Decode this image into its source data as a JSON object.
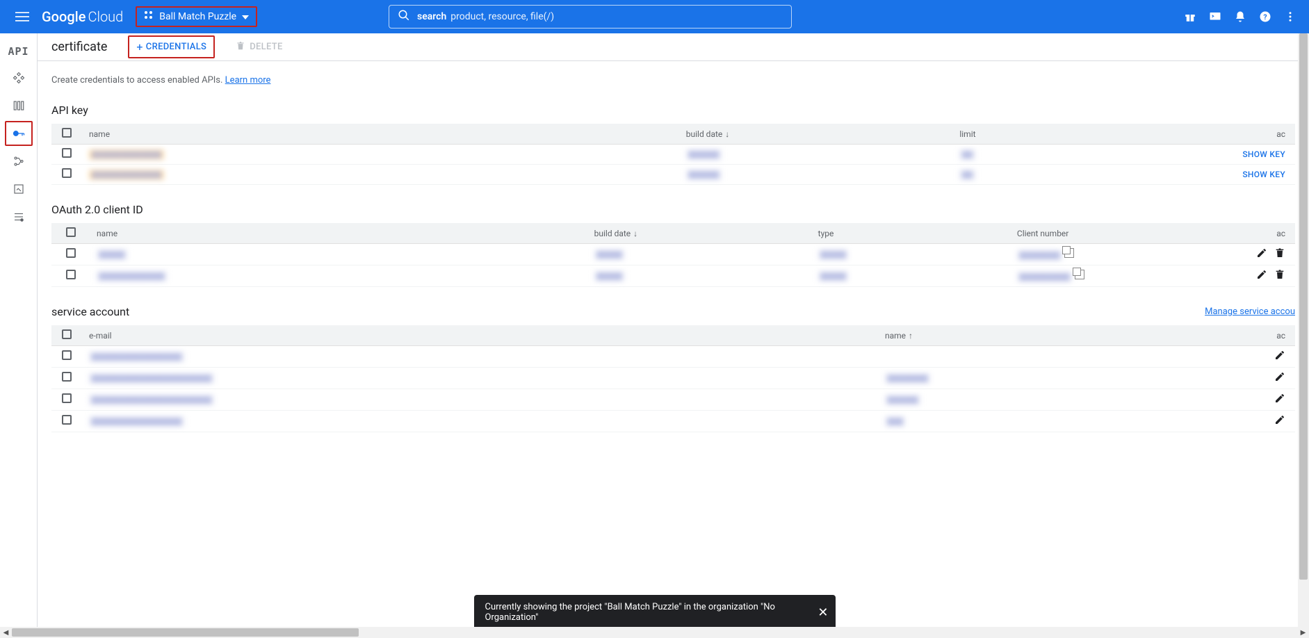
{
  "header": {
    "logo1": "Google",
    "logo2": "Cloud",
    "project_name": "Ball Match Puzzle",
    "search_label": "search",
    "search_placeholder": "product, resource, file(/)"
  },
  "leftrail": {
    "api_label": "API"
  },
  "page": {
    "title": "certificate",
    "create_credentials_btn": "CREDENTIALS",
    "delete_btn": "DELETE",
    "hint_text": "Create credentials to access enabled APIs. ",
    "learn_more": "Learn more"
  },
  "sections": {
    "api_key": {
      "title": "API key",
      "cols": {
        "name": "name",
        "build_date": "build date",
        "limit": "limit",
        "act": "ac"
      },
      "show_key": "SHOW KEY",
      "rows": [
        {
          "name": "▮▮▮▮▮▮▮▮▮▮▮▮▮▮",
          "date": "▮▮▮▮▮▮",
          "limit": "▮▮"
        },
        {
          "name": "▮▮▮▮▮▮▮▮▮▮▮▮▮▮",
          "date": "▮▮▮▮▮▮",
          "limit": "▮▮"
        }
      ]
    },
    "oauth": {
      "title": "OAuth 2.0 client ID",
      "cols": {
        "name": "name",
        "build_date": "build date",
        "type": "type",
        "client_number": "Client number",
        "act": "ac"
      },
      "rows": [
        {
          "name": "▮▮▮▮▮",
          "date": "▮▮▮▮▮",
          "type": "▮▮▮▮▮",
          "client": "▮▮▮▮▮▮▮▮"
        },
        {
          "name": "▮▮▮▮▮▮▮▮▮▮▮▮▮",
          "date": "▮▮▮▮▮",
          "type": "▮▮▮▮▮",
          "client": "▮▮▮▮▮▮▮▮▮▮"
        }
      ]
    },
    "service_account": {
      "title": "service account",
      "manage_link": "Manage service accou",
      "cols": {
        "email": "e-mail",
        "name": "name",
        "act": "ac"
      },
      "rows": [
        {
          "email": "▮▮▮▮▮▮▮▮▮▮▮▮▮▮▮▮▮▮",
          "name": ""
        },
        {
          "email": "▮▮▮▮▮▮▮▮▮▮▮▮▮▮▮▮▮▮▮▮▮▮▮▮",
          "name": "▮▮▮▮▮▮▮▮"
        },
        {
          "email": "▮▮▮▮▮▮▮▮▮▮▮▮▮▮▮▮▮▮▮▮▮▮▮▮",
          "name": "▮▮▮▮▮▮"
        },
        {
          "email": "▮▮▮▮▮▮▮▮▮▮▮▮▮▮▮▮▮▮",
          "name": "▮▮▮"
        }
      ]
    }
  },
  "toast": {
    "message": "Currently showing the project \"Ball Match Puzzle\" in the organization \"No Organization\""
  }
}
